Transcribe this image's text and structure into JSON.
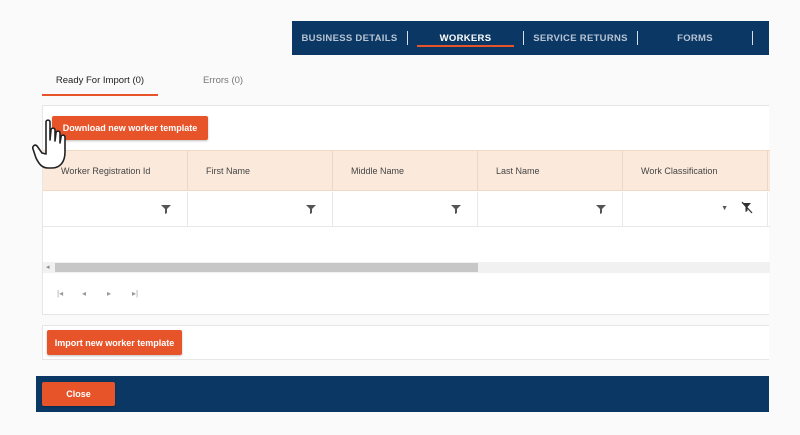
{
  "nav": {
    "tabs": [
      {
        "label": "BUSINESS DETAILS",
        "active": false
      },
      {
        "label": "WORKERS",
        "active": true
      },
      {
        "label": "SERVICE RETURNS",
        "active": false
      },
      {
        "label": "FORMS",
        "active": false
      }
    ]
  },
  "subtabs": [
    {
      "label": "Ready For Import (0)",
      "active": true
    },
    {
      "label": "Errors (0)",
      "active": false
    }
  ],
  "grid": {
    "download_label": "Download new worker template",
    "columns": [
      "Worker Registration Id",
      "First Name",
      "Middle Name",
      "Last Name",
      "Work Classification"
    ],
    "pager_icons": [
      "first-page-icon",
      "prev-page-icon",
      "next-page-icon",
      "last-page-icon"
    ]
  },
  "import": {
    "label": "Import new worker template"
  },
  "footer": {
    "close_label": "Close"
  },
  "colors": {
    "navy": "#0b3764",
    "accent": "#e8542a",
    "header_bg": "#fbeadc"
  }
}
